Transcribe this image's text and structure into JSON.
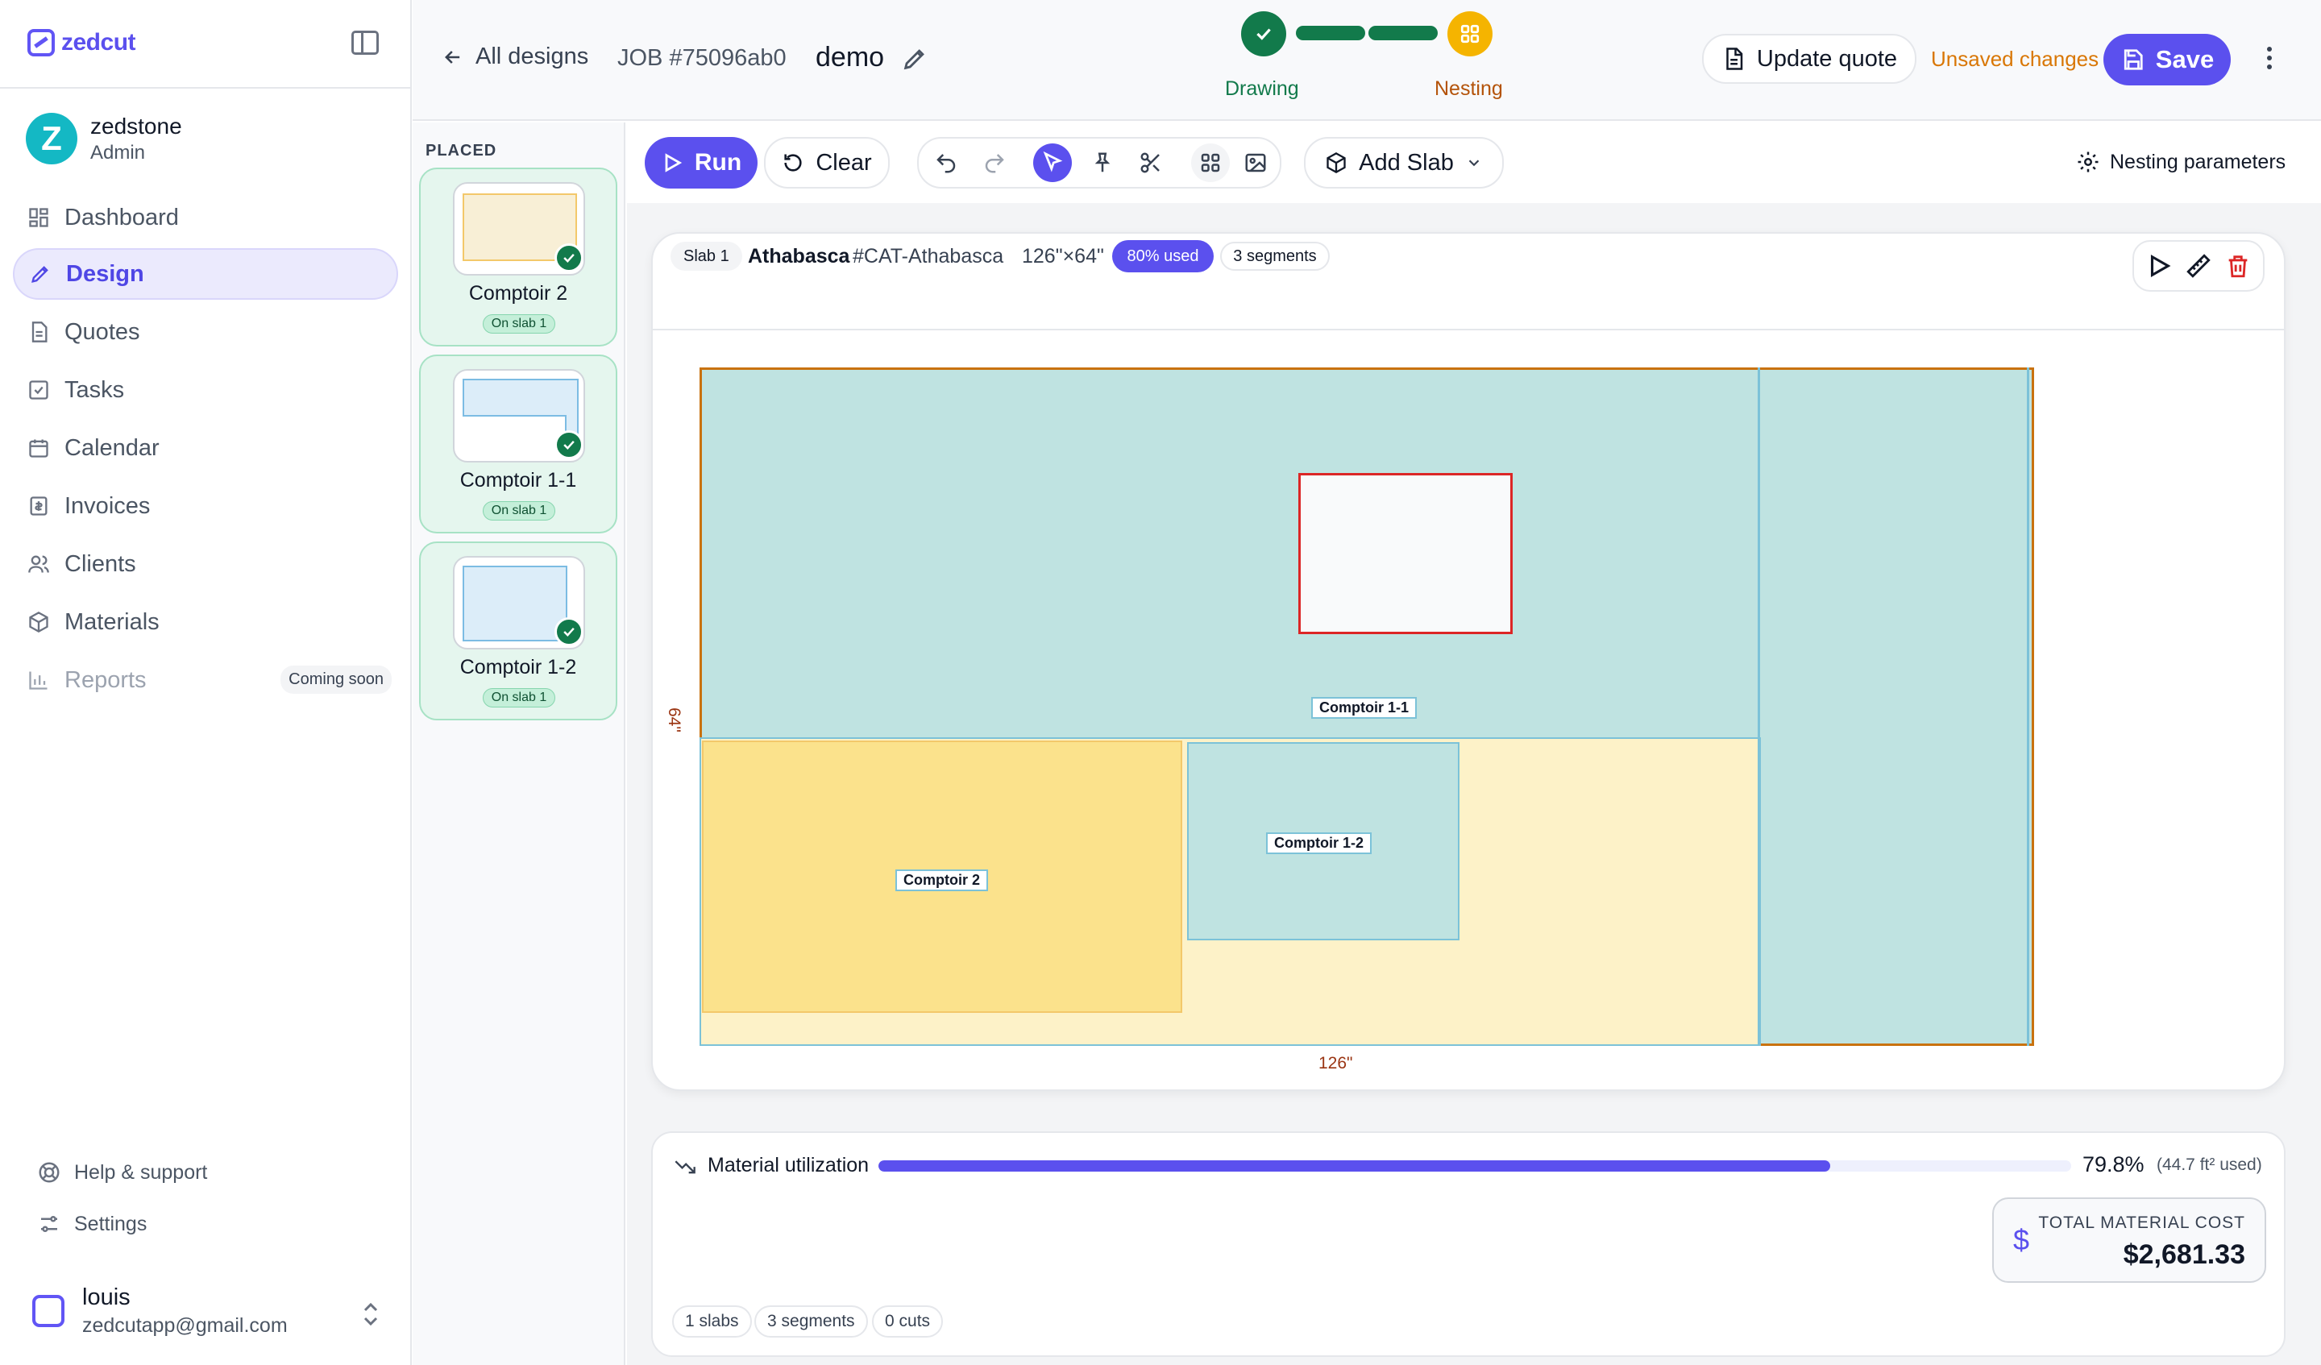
{
  "app": {
    "name": "zedcut"
  },
  "sidebar": {
    "user": {
      "initial": "Z",
      "name": "zedstone",
      "role": "Admin"
    },
    "nav": [
      {
        "label": "Dashboard",
        "icon": "dashboard-icon"
      },
      {
        "label": "Design",
        "icon": "design-icon",
        "active": true
      },
      {
        "label": "Quotes",
        "icon": "quotes-icon"
      },
      {
        "label": "Tasks",
        "icon": "tasks-icon"
      },
      {
        "label": "Calendar",
        "icon": "calendar-icon"
      },
      {
        "label": "Invoices",
        "icon": "invoices-icon"
      },
      {
        "label": "Clients",
        "icon": "clients-icon"
      },
      {
        "label": "Materials",
        "icon": "materials-icon"
      },
      {
        "label": "Reports",
        "icon": "reports-icon",
        "disabled": true,
        "badge": "Coming soon"
      }
    ],
    "footer": {
      "help": "Help & support",
      "settings": "Settings"
    },
    "account": {
      "name": "louis",
      "email": "zedcutapp@gmail.com"
    }
  },
  "header": {
    "back": "All designs",
    "job": "JOB #75096ab0",
    "design_name": "demo",
    "steps": [
      {
        "label": "Drawing",
        "state": "done"
      },
      {
        "label": "Nesting",
        "state": "current"
      }
    ],
    "update_quote": "Update quote",
    "unsaved": "Unsaved changes",
    "save": "Save"
  },
  "placed": {
    "title": "PLACED",
    "pieces": [
      {
        "name": "Comptoir 2",
        "status": "On slab 1",
        "shape": "rect-yellow"
      },
      {
        "name": "Comptoir 1-1",
        "status": "On slab 1",
        "shape": "l-blue"
      },
      {
        "name": "Comptoir 1-2",
        "status": "On slab 1",
        "shape": "rect-blue"
      }
    ]
  },
  "toolbar": {
    "run": "Run",
    "clear": "Clear",
    "add_slab": "Add Slab",
    "nesting_params": "Nesting parameters"
  },
  "slab": {
    "tag": "Slab 1",
    "material": "Athabasca",
    "code": "#CAT-Athabasca",
    "dimensions": "126\"×64\"",
    "used": "80% used",
    "segments": "3 segments",
    "width_label": "126\"",
    "height_label": "64\"",
    "pieces": {
      "comptoir_1_1": "Comptoir 1-1",
      "comptoir_1_2": "Comptoir 1-2",
      "comptoir_2": "Comptoir 2"
    }
  },
  "utilization": {
    "label": "Material utilization",
    "fraction": 0.798,
    "percent": "79.8%",
    "area_used": "(44.7 ft² used)",
    "cost_label": "TOTAL MATERIAL COST",
    "cost_value": "$2,681.33",
    "stats": [
      "1 slabs",
      "3 segments",
      "0 cuts"
    ]
  },
  "colors": {
    "accent": "#5b50ee",
    "success": "#127a4b",
    "warning": "#f5b400",
    "slab_fill": "#bfe3e1",
    "slab_border": "#c9720f"
  }
}
